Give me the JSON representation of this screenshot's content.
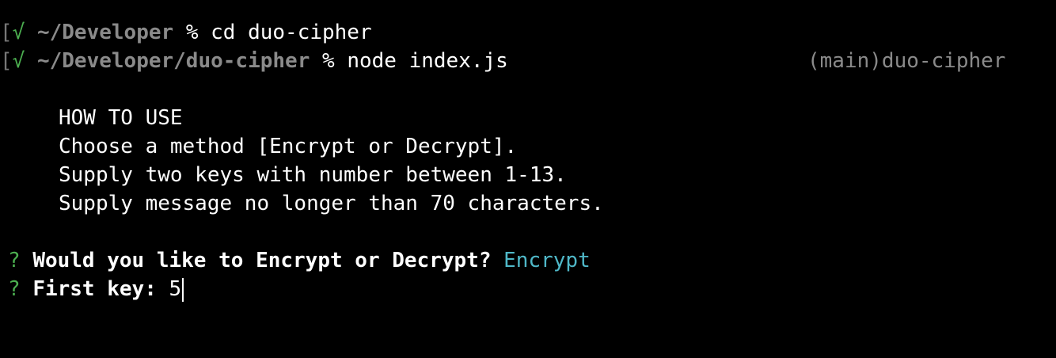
{
  "history": [
    {
      "bracket": "[",
      "check": "√",
      "path": "~/Developer",
      "symbol": "%",
      "command": "cd duo-cipher"
    },
    {
      "bracket": "[",
      "check": "√",
      "path": "~/Developer/duo-cipher",
      "symbol": "%",
      "command": "node index.js"
    }
  ],
  "git_status": "(main)duo-cipher",
  "help": {
    "title": "HOW TO USE",
    "lines": [
      "Choose a method [Encrypt or Decrypt].",
      "Supply two keys with number between 1-13.",
      "Supply message no longer than 70 characters."
    ]
  },
  "prompts": [
    {
      "marker": "?",
      "question": "Would you like to Encrypt or Decrypt?",
      "answer": "Encrypt"
    },
    {
      "marker": "?",
      "question": "First key:",
      "input": "5"
    }
  ],
  "colors": {
    "background": "#000000",
    "success": "#4caf50",
    "path": "#8a8a8a",
    "answer": "#4fb8c8"
  }
}
